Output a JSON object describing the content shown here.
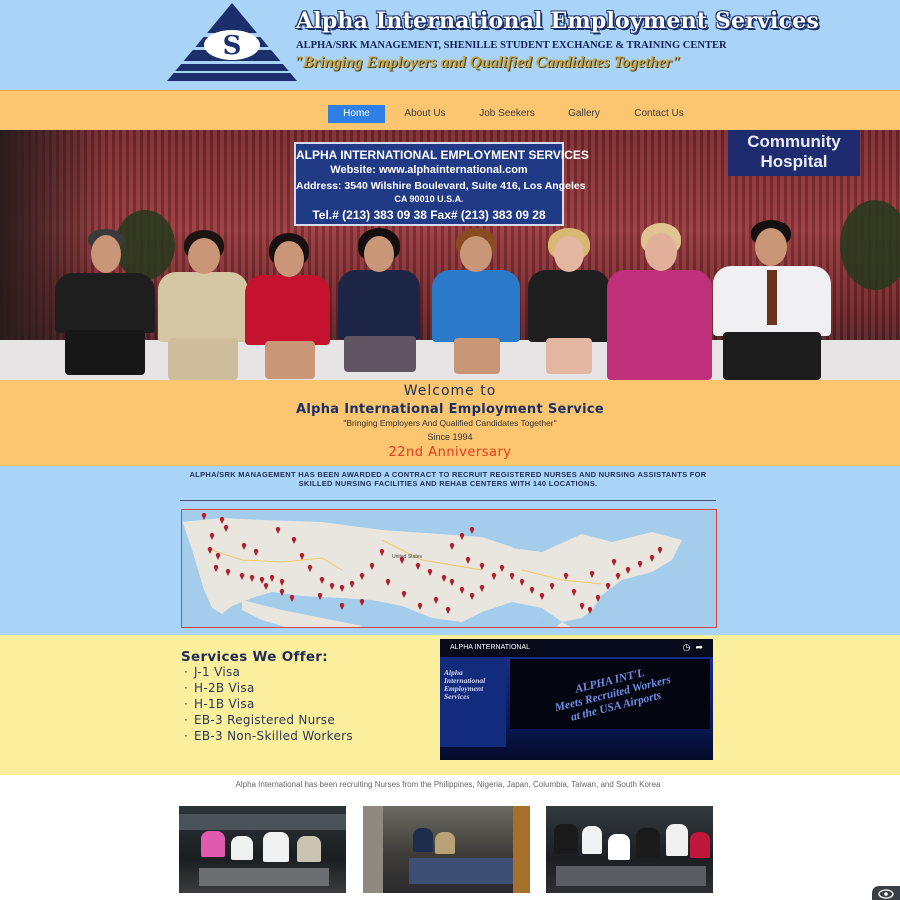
{
  "header": {
    "logo_letter": "S",
    "title": "Alpha International Employment Services",
    "subtitle": "ALPHA/SRK MANAGEMENT, SHENILLE STUDENT EXCHANGE & TRAINING CENTER",
    "tagline": "\"Bringing Employers and Qualified Candidates Together\""
  },
  "nav": {
    "items": [
      "Home",
      "About Us",
      "Job Seekers",
      "Gallery",
      "Contact Us"
    ],
    "active": "Home"
  },
  "hero": {
    "sign_lines": [
      "ALPHA INTERNATIONAL EMPLOYMENT SERVICES",
      "Website: www.alphainternational.com",
      "Address: 3540 Wilshire Boulevard, Suite 416, Los Angeles",
      "CA 90010  U.S.A.",
      "Tel.# (213) 383 09 38  Fax# (213) 383 09 28"
    ],
    "hospital_sign": [
      "Community",
      "Hospital"
    ]
  },
  "welcome": {
    "line1": "Welcome to",
    "line2": "Alpha International Employment Service",
    "line3": "\"Bringing Employers And Qualified Candidates Together\"",
    "line4": "Since 1994",
    "line5": "22nd Anniversary"
  },
  "award": {
    "text": "ALPHA/SRK MANAGEMENT HAS BEEN AWARDED A CONTRACT TO RECRUIT REGISTERED NURSES AND NURSING ASSISTANTS FOR SKILLED NURSING FACILITIES AND REHAB CENTERS WITH 140 LOCATIONS.",
    "map_label": "United States"
  },
  "services": {
    "title": "Services We Offer:",
    "items": [
      "J-1 Visa",
      "H-2B Visa",
      "H-1B Visa",
      "EB-3 Registered Nurse",
      "EB-3 Non-Skilled Workers"
    ]
  },
  "video": {
    "title": "ALPHA INTERNATIONAL",
    "side_text": [
      "Alpha",
      "International",
      "Employment",
      "Services"
    ],
    "banner_lines": [
      "ALPHA INT'L",
      "Meets Recruited Workers",
      "at the USA Airports"
    ]
  },
  "footer": {
    "text": "Alpha International has been recruiting Nurses from the Philippines, Nigeria, Japan, Columbia, Taiwan, and South Korea"
  },
  "colors": {
    "header_bg": "#a9d3f7",
    "nav_bg": "#fcc670",
    "nav_active": "#2e7fe6",
    "services_bg": "#fbee9d",
    "anniversary": "#e63b1e",
    "navy": "#1b2f66"
  },
  "icons": {
    "logo": "triangle-s-logo-icon",
    "video_clock": "clock-icon",
    "video_share": "share-icon",
    "chat": "eye-icon",
    "map_marker": "map-pin-icon"
  }
}
